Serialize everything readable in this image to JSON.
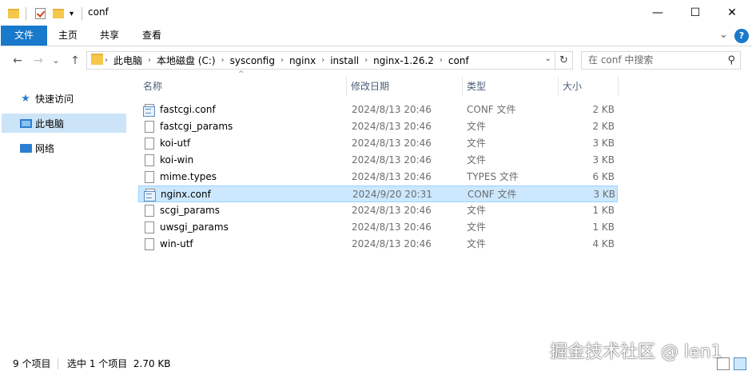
{
  "window": {
    "title": "conf",
    "minimize_glyph": "—",
    "maximize_glyph": "☐",
    "close_glyph": "✕",
    "help_glyph": "?"
  },
  "ribbon": {
    "tabs": [
      "文件",
      "主页",
      "共享",
      "查看"
    ],
    "expand_glyph": "⌄"
  },
  "nav": {
    "back_glyph": "←",
    "forward_glyph": "→",
    "recent_glyph": "⌄",
    "up_glyph": "↑"
  },
  "address": {
    "crumbs": [
      "此电脑",
      "本地磁盘 (C:)",
      "sysconfig",
      "nginx",
      "install",
      "nginx-1.26.2",
      "conf"
    ],
    "dropdown_glyph": "⌄",
    "refresh_glyph": "↻"
  },
  "search": {
    "placeholder": "在 conf 中搜索",
    "icon_glyph": "⚲"
  },
  "sidebar": {
    "items": [
      {
        "label": "快速访问",
        "icon": "star-icon"
      },
      {
        "label": "此电脑",
        "icon": "pc-icon",
        "selected": true
      },
      {
        "label": "网络",
        "icon": "network-icon"
      }
    ]
  },
  "columns": {
    "name": "名称",
    "modified": "修改日期",
    "type": "类型",
    "size": "大小",
    "sort_glyph": "^"
  },
  "files": [
    {
      "name": "fastcgi.conf",
      "modified": "2024/8/13 20:46",
      "type": "CONF 文件",
      "size": "2 KB",
      "icon": "config-file-icon"
    },
    {
      "name": "fastcgi_params",
      "modified": "2024/8/13 20:46",
      "type": "文件",
      "size": "2 KB",
      "icon": "file-icon"
    },
    {
      "name": "koi-utf",
      "modified": "2024/8/13 20:46",
      "type": "文件",
      "size": "3 KB",
      "icon": "file-icon"
    },
    {
      "name": "koi-win",
      "modified": "2024/8/13 20:46",
      "type": "文件",
      "size": "3 KB",
      "icon": "file-icon"
    },
    {
      "name": "mime.types",
      "modified": "2024/8/13 20:46",
      "type": "TYPES 文件",
      "size": "6 KB",
      "icon": "file-icon"
    },
    {
      "name": "nginx.conf",
      "modified": "2024/9/20 20:31",
      "type": "CONF 文件",
      "size": "3 KB",
      "icon": "config-file-icon",
      "selected": true
    },
    {
      "name": "scgi_params",
      "modified": "2024/8/13 20:46",
      "type": "文件",
      "size": "1 KB",
      "icon": "file-icon"
    },
    {
      "name": "uwsgi_params",
      "modified": "2024/8/13 20:46",
      "type": "文件",
      "size": "1 KB",
      "icon": "file-icon"
    },
    {
      "name": "win-utf",
      "modified": "2024/8/13 20:46",
      "type": "文件",
      "size": "4 KB",
      "icon": "file-icon"
    }
  ],
  "status": {
    "count": "9 个项目",
    "selection": "选中 1 个项目  2.70 KB"
  },
  "watermark": "掘金技术社区 @ len1",
  "colors": {
    "accent": "#1979ca",
    "selection_bg": "#cce8ff",
    "selection_border": "#99d1ff",
    "sidebar_selected": "#cce4f7"
  }
}
